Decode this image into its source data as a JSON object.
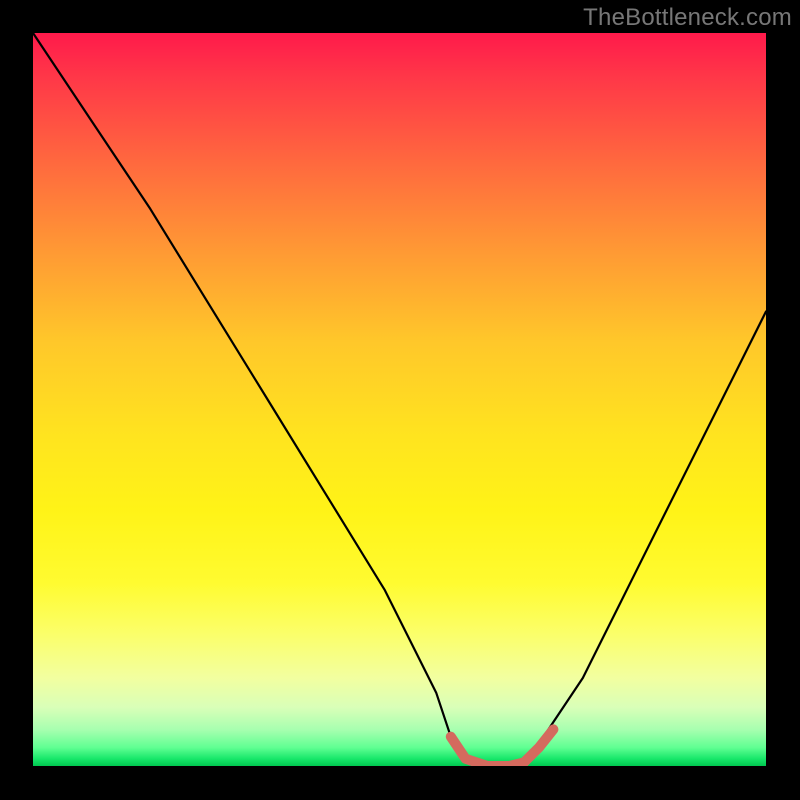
{
  "attribution": "TheBottleneck.com",
  "chart_data": {
    "type": "line",
    "title": "",
    "xlabel": "",
    "ylabel": "",
    "xlim": [
      0,
      100
    ],
    "ylim": [
      0,
      100
    ],
    "series": [
      {
        "name": "bottleneck-curve",
        "x": [
          0,
          8,
          16,
          24,
          32,
          40,
          48,
          55,
          57,
          59,
          62,
          65,
          67,
          69,
          71,
          75,
          80,
          85,
          90,
          95,
          100
        ],
        "values": [
          100,
          88,
          76,
          63,
          50,
          37,
          24,
          10,
          4,
          1,
          0,
          0,
          1,
          3,
          6,
          12,
          22,
          32,
          42,
          52,
          62
        ]
      },
      {
        "name": "optimal-range-marker",
        "x": [
          57,
          59,
          62,
          65,
          67,
          69,
          71
        ],
        "values": [
          4,
          1,
          0,
          0,
          0.5,
          2.5,
          5
        ]
      }
    ],
    "colors": {
      "curve": "#000000",
      "marker": "#d46a5e",
      "bg_top": "#ff1a4b",
      "bg_bottom": "#00c850"
    }
  }
}
